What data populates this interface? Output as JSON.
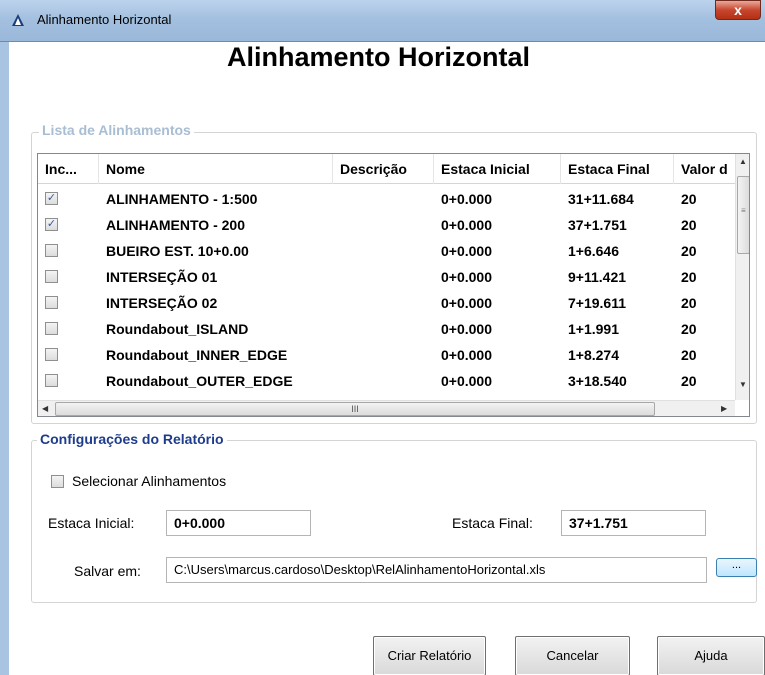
{
  "window": {
    "title": "Alinhamento Horizontal",
    "close_label": "x"
  },
  "heading": "Alinhamento Horizontal",
  "alignments_group": {
    "legend": "Lista de Alinhamentos",
    "columns": [
      "Inc...",
      "Nome",
      "Descrição",
      "Estaca Inicial",
      "Estaca Final",
      "Valor d"
    ],
    "rows": [
      {
        "included": true,
        "nome": "ALINHAMENTO - 1:500",
        "descricao": "",
        "estaca_inicial": "0+0.000",
        "estaca_final": "31+11.684",
        "valor": "20"
      },
      {
        "included": true,
        "nome": "ALINHAMENTO - 200",
        "descricao": "",
        "estaca_inicial": "0+0.000",
        "estaca_final": "37+1.751",
        "valor": "20"
      },
      {
        "included": false,
        "nome": "BUEIRO EST. 10+0.00",
        "descricao": "",
        "estaca_inicial": "0+0.000",
        "estaca_final": "1+6.646",
        "valor": "20"
      },
      {
        "included": false,
        "nome": "INTERSEÇÃO 01",
        "descricao": "",
        "estaca_inicial": "0+0.000",
        "estaca_final": "9+11.421",
        "valor": "20"
      },
      {
        "included": false,
        "nome": "INTERSEÇÃO 02",
        "descricao": "",
        "estaca_inicial": "0+0.000",
        "estaca_final": "7+19.611",
        "valor": "20"
      },
      {
        "included": false,
        "nome": "Roundabout_ISLAND",
        "descricao": "",
        "estaca_inicial": "0+0.000",
        "estaca_final": "1+1.991",
        "valor": "20"
      },
      {
        "included": false,
        "nome": "Roundabout_INNER_EDGE",
        "descricao": "",
        "estaca_inicial": "0+0.000",
        "estaca_final": "1+8.274",
        "valor": "20"
      },
      {
        "included": false,
        "nome": "Roundabout_OUTER_EDGE",
        "descricao": "",
        "estaca_inicial": "0+0.000",
        "estaca_final": "3+18.540",
        "valor": "20"
      }
    ],
    "scroll_grip": "III"
  },
  "report_group": {
    "legend": "Configurações do Relatório",
    "select_alignments_label": "Selecionar Alinhamentos",
    "select_alignments_checked": false,
    "estaca_inicial_label": "Estaca Inicial:",
    "estaca_inicial_value": "0+0.000",
    "estaca_final_label": "Estaca Final:",
    "estaca_final_value": "37+1.751",
    "salvar_label": "Salvar em:",
    "salvar_value": "C:\\Users\\marcus.cardoso\\Desktop\\RelAlinhamentoHorizontal.xls",
    "browse_label": "..."
  },
  "buttons": {
    "criar": "Criar Relatório",
    "cancelar": "Cancelar",
    "ajuda": "Ajuda"
  },
  "colors": {
    "titlebar": "#a4c0e0",
    "legend_disabled": "#a9bdd3",
    "legend_active": "#1e3c8c",
    "close_button": "#c7462e"
  },
  "icons": {
    "app": "autodesk-triangle-icon",
    "close": "close-icon",
    "checked": "check-icon"
  }
}
